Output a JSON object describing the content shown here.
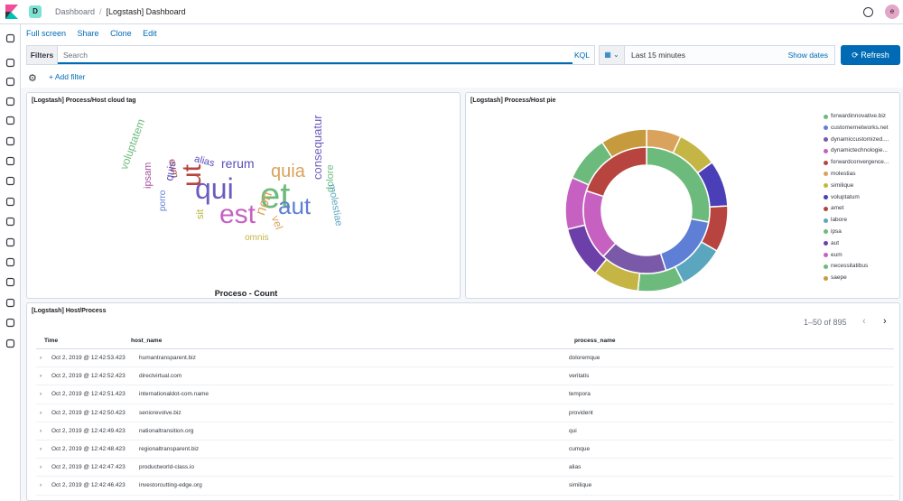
{
  "header": {
    "space_badge": "D",
    "breadcrumbs": [
      "Dashboard",
      "[Logstash] Dashboard"
    ],
    "avatar_initial": "e"
  },
  "menu": [
    "Full screen",
    "Share",
    "Clone",
    "Edit"
  ],
  "query": {
    "filters_label": "Filters",
    "search_placeholder": "Search",
    "language": "KQL",
    "time_range": "Last 15 minutes",
    "show_dates": "Show dates",
    "refresh": "Refresh",
    "add_filter": "+ Add filter"
  },
  "cloud_panel": {
    "title": "[Logstash] Process/Host cloud tag",
    "caption": "Proceso - Count",
    "words": [
      {
        "text": "et",
        "color": "#6dbb7c"
      },
      {
        "text": "qui",
        "color": "#6d5cbf"
      },
      {
        "text": "ut",
        "color": "#b8443f"
      },
      {
        "text": "est",
        "color": "#c661c2"
      },
      {
        "text": "aut",
        "color": "#5f7fd6"
      },
      {
        "text": "quia",
        "color": "#d9a35d"
      },
      {
        "text": "rerum",
        "color": "#5a4fb8"
      },
      {
        "text": "non",
        "color": "#d9a35d"
      },
      {
        "text": "consequatur",
        "color": "#6d5cbf"
      },
      {
        "text": "voluptatem",
        "color": "#6dbb7c"
      },
      {
        "text": "dolore",
        "color": "#6dbb7c"
      },
      {
        "text": "molestiae",
        "color": "#5ba6bf"
      },
      {
        "text": "alias",
        "color": "#5a4fb8"
      },
      {
        "text": "eum",
        "color": "#b8443f"
      },
      {
        "text": "quis",
        "color": "#5a4fb8"
      },
      {
        "text": "ipsam",
        "color": "#a5549f"
      },
      {
        "text": "porro",
        "color": "#5f7fd6"
      },
      {
        "text": "sit",
        "color": "#b5b53b"
      },
      {
        "text": "vel",
        "color": "#d9a35d"
      },
      {
        "text": "omnis",
        "color": "#c4b545"
      }
    ]
  },
  "pie_panel": {
    "title": "[Logstash] Process/Host pie",
    "legend": [
      {
        "label": "forwardinnovative.biz",
        "color": "#6dbb7c"
      },
      {
        "label": "customernetworks.net",
        "color": "#5f7fd6"
      },
      {
        "label": "dynamiccustomized....",
        "color": "#7a5aa8"
      },
      {
        "label": "dynamictechnologie...",
        "color": "#c661c2"
      },
      {
        "label": "forwardconvergence...",
        "color": "#b8443f"
      },
      {
        "label": "molestias",
        "color": "#d9a35d"
      },
      {
        "label": "similique",
        "color": "#c4b545"
      },
      {
        "label": "voluptatum",
        "color": "#4b3fb8"
      },
      {
        "label": "amet",
        "color": "#b8443f"
      },
      {
        "label": "labore",
        "color": "#5ba6bf"
      },
      {
        "label": "ipsa",
        "color": "#6dbb7c"
      },
      {
        "label": "aut",
        "color": "#6d3fa8"
      },
      {
        "label": "eum",
        "color": "#c661c2"
      },
      {
        "label": "necessitatibus",
        "color": "#6dbb7c"
      },
      {
        "label": "saepe",
        "color": "#c69b3d"
      }
    ],
    "outer_ring": [
      {
        "value": 6,
        "color": "#d9a35d"
      },
      {
        "value": 7,
        "color": "#c4b545"
      },
      {
        "value": 8,
        "color": "#4b3fb8"
      },
      {
        "value": 8,
        "color": "#b8443f"
      },
      {
        "value": 8,
        "color": "#5ba6bf"
      },
      {
        "value": 8,
        "color": "#6dbb7c"
      },
      {
        "value": 8,
        "color": "#c4b545"
      },
      {
        "value": 9,
        "color": "#6d3fa8"
      },
      {
        "value": 9,
        "color": "#c661c2"
      },
      {
        "value": 8,
        "color": "#6dbb7c"
      },
      {
        "value": 8,
        "color": "#c69b3d"
      }
    ],
    "inner_ring": [
      {
        "value": 28,
        "color": "#6dbb7c"
      },
      {
        "value": 17,
        "color": "#5f7fd6"
      },
      {
        "value": 17,
        "color": "#7a5aa8"
      },
      {
        "value": 18,
        "color": "#c661c2"
      },
      {
        "value": 20,
        "color": "#b8443f"
      }
    ]
  },
  "table_panel": {
    "title": "[Logstash] Host/Process",
    "pagination": "1–50 of 895",
    "columns": [
      "Time",
      "host_name",
      "process_name"
    ],
    "rows": [
      [
        "Oct 2, 2019 @ 12:42:53.423",
        "humantransparent.biz",
        "doloremque"
      ],
      [
        "Oct 2, 2019 @ 12:42:52.423",
        "directvirtual.com",
        "veritatis"
      ],
      [
        "Oct 2, 2019 @ 12:42:51.423",
        "internationaldot-com.name",
        "tempora"
      ],
      [
        "Oct 2, 2019 @ 12:42:50.423",
        "seniorevolve.biz",
        "provident"
      ],
      [
        "Oct 2, 2019 @ 12:42:49.423",
        "nationaltransition.org",
        "qui"
      ],
      [
        "Oct 2, 2019 @ 12:42:48.423",
        "regionaltransparent.biz",
        "cumque"
      ],
      [
        "Oct 2, 2019 @ 12:42:47.423",
        "productworld-class.io",
        "alias"
      ],
      [
        "Oct 2, 2019 @ 12:42:46.423",
        "investorcutting-edge.org",
        "similique"
      ]
    ]
  }
}
